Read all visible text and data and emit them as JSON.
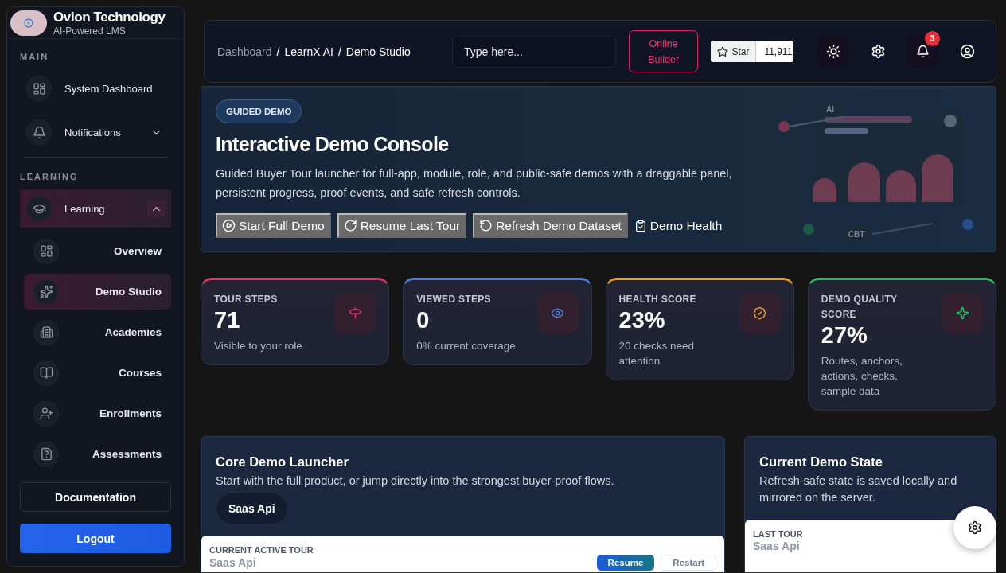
{
  "brand": {
    "name": "Ovion Technology",
    "tagline": "AI-Powered LMS"
  },
  "sidebar": {
    "sections": [
      {
        "title": "MAIN",
        "items": [
          {
            "label": "System Dashboard",
            "selected": false
          },
          {
            "label": "Notifications",
            "selected": false,
            "expanded": false
          }
        ]
      },
      {
        "title": "LEARNING",
        "items": [
          {
            "label": "Learning",
            "selected": true,
            "expanded": true,
            "children": [
              {
                "label": "Overview",
                "selected": false
              },
              {
                "label": "Demo Studio",
                "selected": true
              },
              {
                "label": "Academies",
                "selected": false
              },
              {
                "label": "Courses",
                "selected": false
              },
              {
                "label": "Enrollments",
                "selected": false
              },
              {
                "label": "Assessments",
                "selected": false
              }
            ]
          }
        ]
      }
    ],
    "footer_buttons": [
      {
        "label": "Documentation",
        "kind": "outline"
      },
      {
        "label": "Logout",
        "kind": "primary"
      }
    ]
  },
  "topbar": {
    "breadcrumb": [
      {
        "label": "Dashboard",
        "current": false
      },
      {
        "label": "LearnX AI",
        "current": true
      },
      {
        "label": "Demo Studio",
        "current": true
      }
    ],
    "breadcrumb_separator": "/",
    "search": {
      "placeholder": "Type here..."
    },
    "builder_button": "Online Builder",
    "star": {
      "label": "Star",
      "count": "11,911"
    },
    "notification_count": "3"
  },
  "hero": {
    "badge": "GUIDED DEMO",
    "title": "Interactive Demo Console",
    "description": "Guided Buyer Tour launcher for full-app, module, role, and public-safe demos with a draggable panel, persistent progress, proof events, and safe refresh controls.",
    "actions": [
      {
        "label": "Start Full Demo",
        "kind": "button"
      },
      {
        "label": "Resume Last Tour",
        "kind": "button"
      },
      {
        "label": "Refresh Demo Dataset",
        "kind": "button"
      },
      {
        "label": "Demo Health",
        "kind": "link"
      }
    ],
    "illustration_labels": [
      "AI",
      "CBT"
    ]
  },
  "stats": [
    {
      "label": "TOUR STEPS",
      "value": "71",
      "note": "Visible to your role",
      "color": "#e0336f"
    },
    {
      "label": "VIEWED STEPS",
      "value": "0",
      "note": "0% current coverage",
      "color": "#4f7fe0"
    },
    {
      "label": "HEALTH SCORE",
      "value": "23%",
      "note": "20 checks need attention",
      "color": "#e0a030"
    },
    {
      "label": "DEMO QUALITY SCORE",
      "value": "27%",
      "note": "Routes, anchors, actions, checks, sample data",
      "color": "#2fb86a"
    }
  ],
  "launcher": {
    "title": "Core Demo Launcher",
    "description": "Start with the full product, or jump directly into the strongest buyer-proof flows.",
    "chips": [
      "Saas Api"
    ],
    "active_tour": {
      "label": "CURRENT ACTIVE TOUR",
      "name": "Saas Api",
      "buttons": [
        {
          "label": "Resume",
          "kind": "primary"
        },
        {
          "label": "Restart",
          "kind": "ghost"
        }
      ]
    }
  },
  "state": {
    "title": "Current Demo State",
    "description": "Refresh-safe state is saved locally and mirrored on the server.",
    "last_tour": {
      "label": "LAST TOUR",
      "name": "Saas Api"
    }
  }
}
